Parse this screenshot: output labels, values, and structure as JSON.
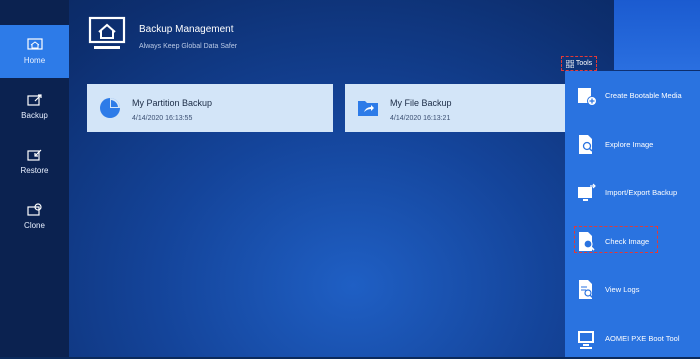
{
  "sidebar": {
    "items": [
      {
        "label": "Home",
        "icon": "home-icon",
        "active": true
      },
      {
        "label": "Backup",
        "icon": "backup-icon"
      },
      {
        "label": "Restore",
        "icon": "restore-icon"
      },
      {
        "label": "Clone",
        "icon": "clone-icon"
      }
    ]
  },
  "header": {
    "title": "Backup Management",
    "subtitle": "Always Keep Global Data Safer",
    "icon": "monitor-home-icon"
  },
  "tasks": [
    {
      "name": "My Partition Backup",
      "date": "4/14/2020 16:13:55",
      "icon": "pie-chart-icon"
    },
    {
      "name": "My File Backup",
      "date": "4/14/2020 16:13:21",
      "icon": "folder-share-icon"
    }
  ],
  "tools": {
    "button_label": "Tools",
    "items": [
      {
        "label": "Create Bootable Media",
        "icon": "bootable-media-icon"
      },
      {
        "label": "Explore Image",
        "icon": "explore-image-icon"
      },
      {
        "label": "Import/Export Backup",
        "icon": "import-export-icon"
      },
      {
        "label": "Check Image",
        "icon": "check-image-icon",
        "highlighted": true
      },
      {
        "label": "View Logs",
        "icon": "view-logs-icon"
      },
      {
        "label": "AOMEI PXE Boot Tool",
        "icon": "pxe-boot-icon"
      }
    ]
  },
  "colors": {
    "accent": "#2d7be8",
    "highlight": "#e53935",
    "card": "#d3e5f8"
  }
}
